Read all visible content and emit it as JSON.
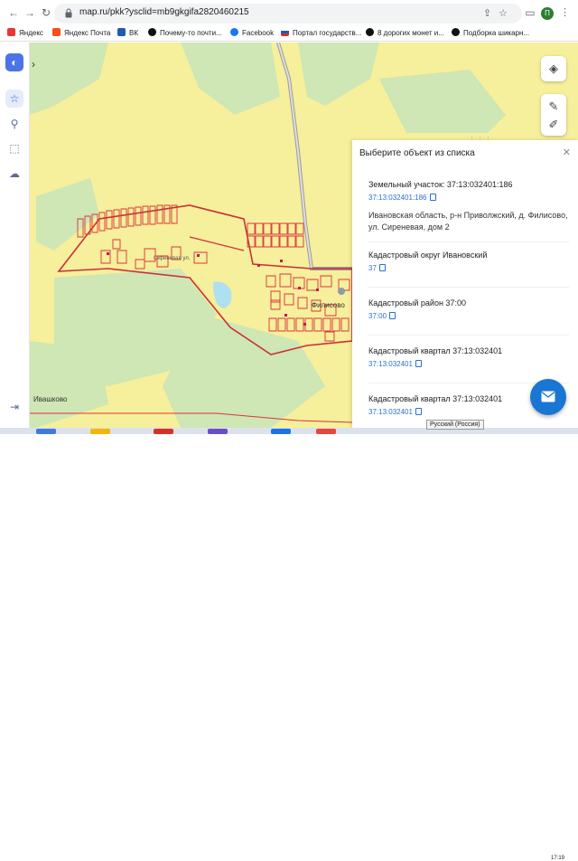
{
  "browser": {
    "url": "map.ru/pkk?ysclid=mb9gkgifa2820460215",
    "profile_initial": "П",
    "bookmarks": [
      {
        "label": "Яндекс",
        "color": "#e53935"
      },
      {
        "label": "Яндекс Почта",
        "color": "#f4511e"
      },
      {
        "label": "ВК",
        "color": "#1e5bb7"
      },
      {
        "label": "Почему-то почти...",
        "color": "#111111"
      },
      {
        "label": "Facebook",
        "color": "#1877f2"
      },
      {
        "label": "Портал государств...",
        "color": "#d32f2f"
      },
      {
        "label": "8 дорогих монет и...",
        "color": "#111111"
      },
      {
        "label": "Подборка шикарн...",
        "color": "#111111"
      }
    ]
  },
  "map": {
    "labels": {
      "filisovo": "Филисово",
      "ivashkovo": "Ивашково",
      "street": "Сиреневая ул."
    },
    "colors": {
      "field": "#f6ef9b",
      "forest": "#cfe6b5",
      "parcel": "#d9343b",
      "road": "#9a9a9a"
    }
  },
  "panel": {
    "title": "Выберите объект из списка",
    "items": [
      {
        "title": "Земельный участок: 37:13:032401:186",
        "link": "37:13:032401:186",
        "address": "Ивановская область, р-н Приволжский, д. Филисово, ул. Сиреневая, дом 2"
      },
      {
        "title": "Кадастровый округ Ивановский",
        "link": "37"
      },
      {
        "title": "Кадастровый район 37:00",
        "link": "37:00"
      },
      {
        "title": "Кадастровый квартал 37:13:032401",
        "link": "37:13:032401"
      },
      {
        "title": "Кадастровый квартал 37:13:032401",
        "link": "37:13:032401"
      }
    ]
  },
  "taskbar": {
    "tooltip": "Русский (Россия)",
    "clock": "17:19"
  }
}
